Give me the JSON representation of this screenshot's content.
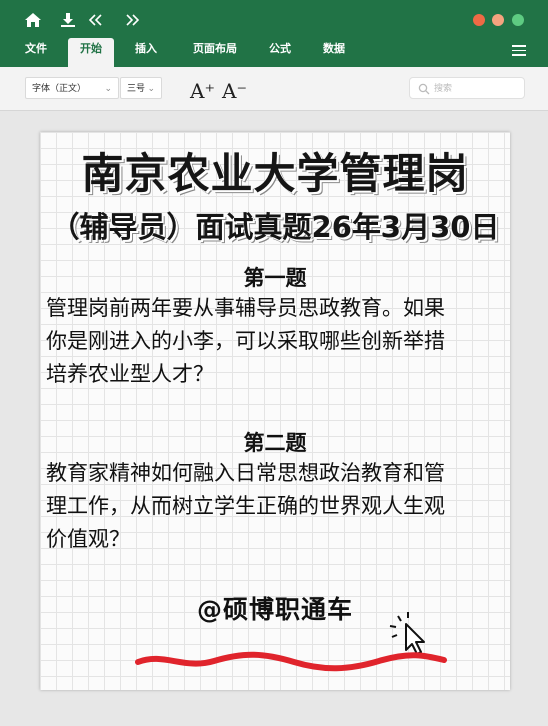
{
  "ribbon": {
    "tabs": [
      "文件",
      "开始",
      "插入",
      "页面布局",
      "公式",
      "数据"
    ],
    "active_tab": "开始",
    "font_name": "字体（正文）",
    "font_size": "三号",
    "grow_font": "A⁺",
    "shrink_font": "A⁻",
    "search_placeholder": "搜索"
  },
  "window_buttons": {
    "close": "#ee6a45",
    "minimize": "#f5a37f",
    "maximize": "#5ecb82"
  },
  "colors": {
    "ribbon_green": "#217346",
    "underline_red": "#e0242c"
  },
  "document": {
    "title_line1": "南京农业大学管理岗",
    "title_line2": "（辅导员）面试真题26年3月30日",
    "q1": {
      "heading": "第一题",
      "lines": [
        "管理岗前两年要从事辅导员思政教育。如果",
        "你是刚进入的小李，可以采取哪些创新举措",
        "培养农业型人才？"
      ]
    },
    "q2": {
      "heading": "第二题",
      "lines": [
        "教育家精神如何融入日常思想政治教育和管",
        "理工作，从而树立学生正确的世界观人生观",
        "价值观？"
      ]
    },
    "signature": "@硕博职通车"
  }
}
